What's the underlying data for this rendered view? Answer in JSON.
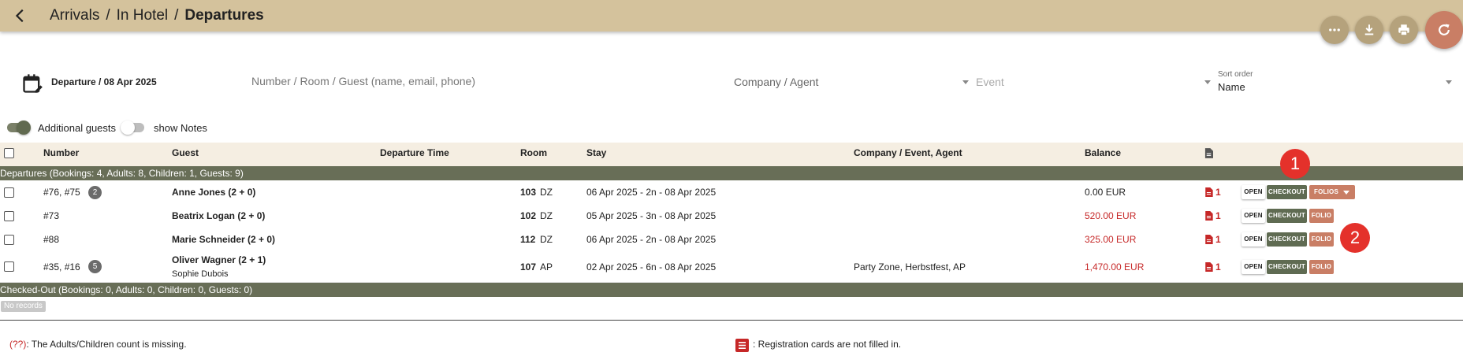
{
  "breadcrumb": {
    "items": [
      "Arrivals",
      "In Hotel"
    ],
    "separator": "/",
    "current": "Departures"
  },
  "filters": {
    "date": "Departure / 08 Apr 2025",
    "search_placeholder": "Number / Room / Guest (name, email, phone)",
    "company": "Company / Agent",
    "event": "Event",
    "sort_caption": "Sort order",
    "sort_value": "Name"
  },
  "toggles": {
    "additional_guests": "Additional guests",
    "show_notes": "show Notes"
  },
  "columns": {
    "number": "Number",
    "guest": "Guest",
    "departure_time": "Departure Time",
    "room": "Room",
    "stay": "Stay",
    "company": "Company / Event, Agent",
    "balance": "Balance"
  },
  "groups": {
    "departures": "Departures (Bookings: 4, Adults: 8, Children: 1, Guests: 9)",
    "checked_out": "Checked-Out (Bookings: 0, Adults: 0, Children: 0, Guests: 0)",
    "no_records": "No records"
  },
  "rows": [
    {
      "number": "#76, #75",
      "badge": "2",
      "guest": "Anne Jones (2 + 0)",
      "room_no": "103",
      "room_type": "DZ",
      "stay": "06 Apr 2025 - 2n - 08 Apr 2025",
      "company": "",
      "balance": "0.00 EUR",
      "cards": "1",
      "open": "OPEN",
      "checkout": "CHECKOUT",
      "folio": "FOLIOS"
    },
    {
      "number": "#73",
      "guest": "Beatrix Logan (2 + 0)",
      "room_no": "102",
      "room_type": "DZ",
      "stay": "05 Apr 2025 - 3n - 08 Apr 2025",
      "company": "",
      "balance": "520.00 EUR",
      "cards": "1",
      "open": "OPEN",
      "checkout": "CHECKOUT",
      "folio": "FOLIO"
    },
    {
      "number": "#88",
      "guest": "Marie Schneider (2 + 0)",
      "room_no": "112",
      "room_type": "DZ",
      "stay": "06 Apr 2025 - 2n - 08 Apr 2025",
      "company": "",
      "balance": "325.00 EUR",
      "cards": "1",
      "open": "OPEN",
      "checkout": "CHECKOUT",
      "folio": "FOLIO"
    },
    {
      "number": "#35, #16",
      "badge": "5",
      "guest": "Oliver Wagner (2 + 1)",
      "guest2": "Sophie Dubois",
      "room_no": "107",
      "room_type": "AP",
      "stay": "02 Apr 2025 - 6n - 08 Apr 2025",
      "company": "Party Zone, Herbstfest, AP",
      "balance": "1,470.00 EUR",
      "cards": "1",
      "open": "OPEN",
      "checkout": "CHECKOUT",
      "folio": "FOLIO"
    }
  ],
  "legend": {
    "missing_code": "(??)",
    "missing_text": ": The Adults/Children count is missing.",
    "cards_text": ": Registration cards are not filled in."
  },
  "markers": [
    "1",
    "2"
  ],
  "colors": {
    "header": "#d4c29c",
    "group": "#686e57",
    "checkout": "#5f6b52",
    "folio": "#c97e65",
    "negative": "#c62828",
    "marker": "#e4312b"
  }
}
